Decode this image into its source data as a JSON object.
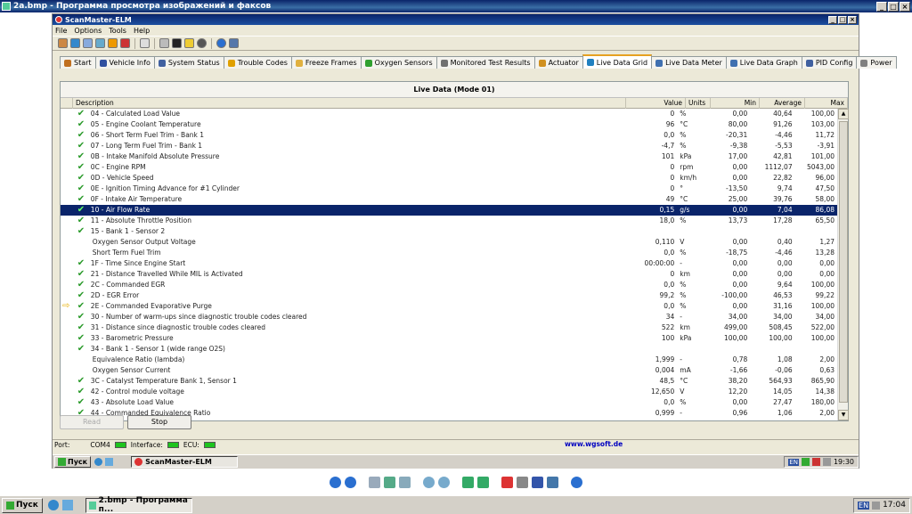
{
  "outer": {
    "title": "2a.bmp - Программа просмотра изображений и факсов"
  },
  "app": {
    "title": "ScanMaster-ELM",
    "menu": [
      "File",
      "Options",
      "Tools",
      "Help"
    ],
    "tabs": [
      {
        "label": "Start",
        "color": "#c07020"
      },
      {
        "label": "Vehicle Info",
        "color": "#3050a0"
      },
      {
        "label": "System Status",
        "color": "#4060a0"
      },
      {
        "label": "Trouble Codes",
        "color": "#e0a000"
      },
      {
        "label": "Freeze Frames",
        "color": "#e0b040"
      },
      {
        "label": "Oxygen Sensors",
        "color": "#30a030"
      },
      {
        "label": "Monitored Test Results",
        "color": "#707070"
      },
      {
        "label": "Actuator",
        "color": "#d09020"
      },
      {
        "label": "Live Data Grid",
        "color": "#2080c0"
      },
      {
        "label": "Live Data Meter",
        "color": "#4070b0"
      },
      {
        "label": "Live Data Graph",
        "color": "#4070b0"
      },
      {
        "label": "PID Config",
        "color": "#4060a0"
      },
      {
        "label": "Power",
        "color": "#808080"
      }
    ],
    "active_tab": "Live Data Grid"
  },
  "grid": {
    "heading": "Live Data (Mode 01)",
    "columns": {
      "desc": "Description",
      "val": "Value",
      "unit": "Units",
      "min": "Min",
      "avg": "Average",
      "max": "Max"
    },
    "rows": [
      {
        "d": "04 - Calculated Load Value",
        "v": "0",
        "u": "%",
        "mn": "0,00",
        "av": "40,64",
        "mx": "100,00",
        "chk": true
      },
      {
        "d": "05 - Engine Coolant Temperature",
        "v": "96",
        "u": "°C",
        "mn": "80,00",
        "av": "91,26",
        "mx": "103,00",
        "chk": true
      },
      {
        "d": "06 - Short Term Fuel Trim - Bank 1",
        "v": "0,0",
        "u": "%",
        "mn": "-20,31",
        "av": "-4,46",
        "mx": "11,72",
        "chk": true
      },
      {
        "d": "07 - Long Term Fuel Trim - Bank 1",
        "v": "-4,7",
        "u": "%",
        "mn": "-9,38",
        "av": "-5,53",
        "mx": "-3,91",
        "chk": true
      },
      {
        "d": "0B - Intake Manifold Absolute Pressure",
        "v": "101",
        "u": "kPa",
        "mn": "17,00",
        "av": "42,81",
        "mx": "101,00",
        "chk": true
      },
      {
        "d": "0C - Engine RPM",
        "v": "0",
        "u": "rpm",
        "mn": "0,00",
        "av": "1112,07",
        "mx": "5043,00",
        "chk": true
      },
      {
        "d": "0D - Vehicle Speed",
        "v": "0",
        "u": "km/h",
        "mn": "0,00",
        "av": "22,82",
        "mx": "96,00",
        "chk": true
      },
      {
        "d": "0E - Ignition Timing Advance for #1 Cylinder",
        "v": "0",
        "u": "°",
        "mn": "-13,50",
        "av": "9,74",
        "mx": "47,50",
        "chk": true
      },
      {
        "d": "0F - Intake Air Temperature",
        "v": "49",
        "u": "°C",
        "mn": "25,00",
        "av": "39,76",
        "mx": "58,00",
        "chk": true
      },
      {
        "d": "10 - Air Flow Rate",
        "v": "0,15",
        "u": "g/s",
        "mn": "0,00",
        "av": "7,04",
        "mx": "86,08",
        "chk": true,
        "sel": true
      },
      {
        "d": "11 - Absolute Throttle Position",
        "v": "18,0",
        "u": "%",
        "mn": "13,73",
        "av": "17,28",
        "mx": "65,50",
        "chk": true
      },
      {
        "d": "15 - Bank 1 - Sensor 2",
        "v": "",
        "u": "",
        "mn": "",
        "av": "",
        "mx": "",
        "chk": true
      },
      {
        "d": "Oxygen Sensor Output Voltage",
        "v": "0,110",
        "u": "V",
        "mn": "0,00",
        "av": "0,40",
        "mx": "1,27",
        "sub": true
      },
      {
        "d": "Short Term Fuel Trim",
        "v": "0,0",
        "u": "%",
        "mn": "-18,75",
        "av": "-4,46",
        "mx": "13,28",
        "sub": true
      },
      {
        "d": "1F - Time Since Engine Start",
        "v": "00:00:00",
        "u": "-",
        "mn": "0,00",
        "av": "0,00",
        "mx": "0,00",
        "chk": true
      },
      {
        "d": "21 - Distance Travelled While MIL is Activated",
        "v": "0",
        "u": "km",
        "mn": "0,00",
        "av": "0,00",
        "mx": "0,00",
        "chk": true
      },
      {
        "d": "2C - Commanded EGR",
        "v": "0,0",
        "u": "%",
        "mn": "0,00",
        "av": "9,64",
        "mx": "100,00",
        "chk": true
      },
      {
        "d": "2D - EGR Error",
        "v": "99,2",
        "u": "%",
        "mn": "-100,00",
        "av": "46,53",
        "mx": "99,22",
        "chk": true
      },
      {
        "d": "2E - Commanded Evaporative Purge",
        "v": "0,0",
        "u": "%",
        "mn": "0,00",
        "av": "31,16",
        "mx": "100,00",
        "chk": true,
        "ptr": true
      },
      {
        "d": "30 - Number of warm-ups since diagnostic trouble codes cleared",
        "v": "34",
        "u": "-",
        "mn": "34,00",
        "av": "34,00",
        "mx": "34,00",
        "chk": true
      },
      {
        "d": "31 - Distance since diagnostic trouble codes cleared",
        "v": "522",
        "u": "km",
        "mn": "499,00",
        "av": "508,45",
        "mx": "522,00",
        "chk": true
      },
      {
        "d": "33 - Barometric Pressure",
        "v": "100",
        "u": "kPa",
        "mn": "100,00",
        "av": "100,00",
        "mx": "100,00",
        "chk": true
      },
      {
        "d": "34 - Bank 1 - Sensor 1 (wide range O2S)",
        "v": "",
        "u": "",
        "mn": "",
        "av": "",
        "mx": "",
        "chk": true
      },
      {
        "d": "Equivalence Ratio (lambda)",
        "v": "1,999",
        "u": "-",
        "mn": "0,78",
        "av": "1,08",
        "mx": "2,00",
        "sub": true
      },
      {
        "d": "Oxygen Sensor Current",
        "v": "0,004",
        "u": "mA",
        "mn": "-1,66",
        "av": "-0,06",
        "mx": "0,63",
        "sub": true
      },
      {
        "d": "3C - Catalyst Temperature Bank 1, Sensor 1",
        "v": "48,5",
        "u": "°C",
        "mn": "38,20",
        "av": "564,93",
        "mx": "865,90",
        "chk": true
      },
      {
        "d": "42 - Control module voltage",
        "v": "12,650",
        "u": "V",
        "mn": "12,20",
        "av": "14,05",
        "mx": "14,38",
        "chk": true
      },
      {
        "d": "43 - Absolute Load Value",
        "v": "0,0",
        "u": "%",
        "mn": "0,00",
        "av": "27,47",
        "mx": "180,00",
        "chk": true
      },
      {
        "d": "44 - Commanded Equivalence Ratio",
        "v": "0,999",
        "u": "-",
        "mn": "0,96",
        "av": "1,06",
        "mx": "2,00",
        "chk": true
      }
    ]
  },
  "buttons": {
    "read": "Read",
    "stop": "Stop"
  },
  "status": {
    "port_label": "Port:",
    "port": "COM4",
    "interface": "Interface:",
    "ecu": "ECU:",
    "url": "www.wgsoft.de"
  },
  "inner_taskbar": {
    "start": "Пуск",
    "item": "ScanMaster-ELM",
    "time": "19:30",
    "lang": "EN"
  },
  "os_taskbar": {
    "start": "Пуск",
    "item": "2.bmp - Программа п...",
    "time": "17:04",
    "lang": "EN"
  }
}
